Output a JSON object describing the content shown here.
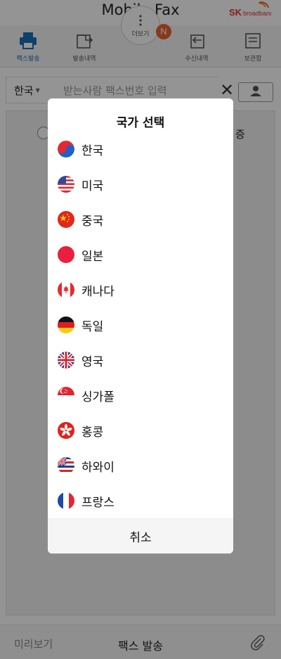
{
  "app": {
    "title": "Mobile Fax",
    "brand": {
      "sk": "SK",
      "name": "broadband"
    }
  },
  "tabs": [
    {
      "label": "팩스발송",
      "icon": "printer-icon",
      "active": true
    },
    {
      "label": "발송내역",
      "icon": "outbox-icon",
      "active": false
    },
    {
      "label": "더보기",
      "icon": "more-icon",
      "active": false
    },
    {
      "label": "수신내역",
      "icon": "inbox-icon",
      "active": false
    },
    {
      "label": "보관함",
      "icon": "archive-icon",
      "active": false
    }
  ],
  "badge": "N",
  "input_bar": {
    "country": "한국",
    "placeholder": "받는사람 팩스번호 입력",
    "clear": "✕"
  },
  "content": {
    "peek_text": "증"
  },
  "bottom": {
    "preview": "미리보기",
    "send": "팩스 발송"
  },
  "dialog": {
    "title": "국가 선택",
    "countries": [
      {
        "name": "한국",
        "flag": "korea-flag-icon"
      },
      {
        "name": "미국",
        "flag": "usa-flag-icon"
      },
      {
        "name": "중국",
        "flag": "china-flag-icon"
      },
      {
        "name": "일본",
        "flag": "japan-flag-icon"
      },
      {
        "name": "캐나다",
        "flag": "canada-flag-icon"
      },
      {
        "name": "독일",
        "flag": "germany-flag-icon"
      },
      {
        "name": "영국",
        "flag": "uk-flag-icon"
      },
      {
        "name": "싱가폴",
        "flag": "singapore-flag-icon"
      },
      {
        "name": "홍콩",
        "flag": "hongkong-flag-icon"
      },
      {
        "name": "하와이",
        "flag": "hawaii-flag-icon"
      },
      {
        "name": "프랑스",
        "flag": "france-flag-icon"
      }
    ],
    "cancel": "취소"
  },
  "colors": {
    "accent": "#1a6fb9",
    "badge": "#e8622f",
    "brand_red": "#e4322b",
    "brand_orange": "#f39800"
  }
}
